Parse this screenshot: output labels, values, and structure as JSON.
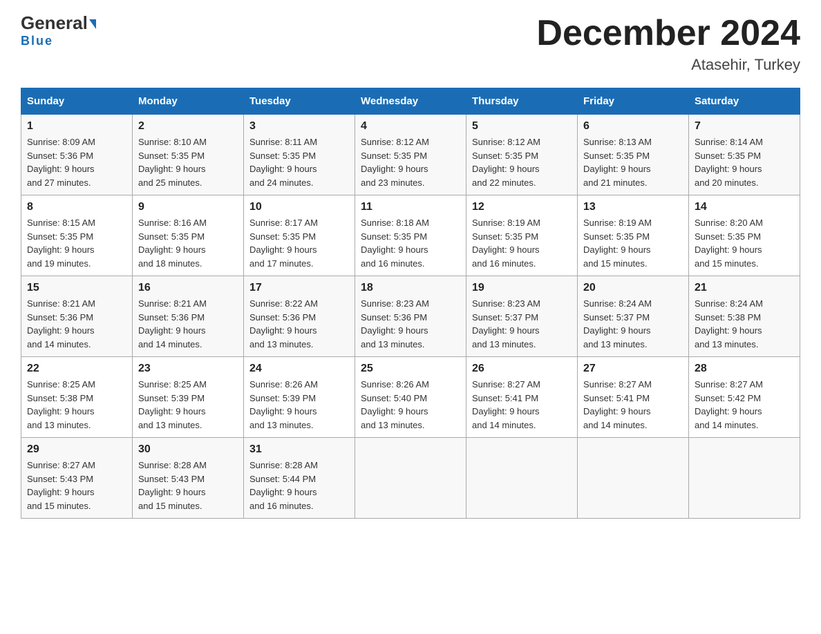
{
  "header": {
    "logo_general": "General",
    "logo_blue": "Blue",
    "title": "December 2024",
    "location": "Atasehir, Turkey"
  },
  "days_of_week": [
    "Sunday",
    "Monday",
    "Tuesday",
    "Wednesday",
    "Thursday",
    "Friday",
    "Saturday"
  ],
  "weeks": [
    [
      {
        "day": "1",
        "sunrise": "8:09 AM",
        "sunset": "5:36 PM",
        "daylight": "9 hours and 27 minutes."
      },
      {
        "day": "2",
        "sunrise": "8:10 AM",
        "sunset": "5:35 PM",
        "daylight": "9 hours and 25 minutes."
      },
      {
        "day": "3",
        "sunrise": "8:11 AM",
        "sunset": "5:35 PM",
        "daylight": "9 hours and 24 minutes."
      },
      {
        "day": "4",
        "sunrise": "8:12 AM",
        "sunset": "5:35 PM",
        "daylight": "9 hours and 23 minutes."
      },
      {
        "day": "5",
        "sunrise": "8:12 AM",
        "sunset": "5:35 PM",
        "daylight": "9 hours and 22 minutes."
      },
      {
        "day": "6",
        "sunrise": "8:13 AM",
        "sunset": "5:35 PM",
        "daylight": "9 hours and 21 minutes."
      },
      {
        "day": "7",
        "sunrise": "8:14 AM",
        "sunset": "5:35 PM",
        "daylight": "9 hours and 20 minutes."
      }
    ],
    [
      {
        "day": "8",
        "sunrise": "8:15 AM",
        "sunset": "5:35 PM",
        "daylight": "9 hours and 19 minutes."
      },
      {
        "day": "9",
        "sunrise": "8:16 AM",
        "sunset": "5:35 PM",
        "daylight": "9 hours and 18 minutes."
      },
      {
        "day": "10",
        "sunrise": "8:17 AM",
        "sunset": "5:35 PM",
        "daylight": "9 hours and 17 minutes."
      },
      {
        "day": "11",
        "sunrise": "8:18 AM",
        "sunset": "5:35 PM",
        "daylight": "9 hours and 16 minutes."
      },
      {
        "day": "12",
        "sunrise": "8:19 AM",
        "sunset": "5:35 PM",
        "daylight": "9 hours and 16 minutes."
      },
      {
        "day": "13",
        "sunrise": "8:19 AM",
        "sunset": "5:35 PM",
        "daylight": "9 hours and 15 minutes."
      },
      {
        "day": "14",
        "sunrise": "8:20 AM",
        "sunset": "5:35 PM",
        "daylight": "9 hours and 15 minutes."
      }
    ],
    [
      {
        "day": "15",
        "sunrise": "8:21 AM",
        "sunset": "5:36 PM",
        "daylight": "9 hours and 14 minutes."
      },
      {
        "day": "16",
        "sunrise": "8:21 AM",
        "sunset": "5:36 PM",
        "daylight": "9 hours and 14 minutes."
      },
      {
        "day": "17",
        "sunrise": "8:22 AM",
        "sunset": "5:36 PM",
        "daylight": "9 hours and 13 minutes."
      },
      {
        "day": "18",
        "sunrise": "8:23 AM",
        "sunset": "5:36 PM",
        "daylight": "9 hours and 13 minutes."
      },
      {
        "day": "19",
        "sunrise": "8:23 AM",
        "sunset": "5:37 PM",
        "daylight": "9 hours and 13 minutes."
      },
      {
        "day": "20",
        "sunrise": "8:24 AM",
        "sunset": "5:37 PM",
        "daylight": "9 hours and 13 minutes."
      },
      {
        "day": "21",
        "sunrise": "8:24 AM",
        "sunset": "5:38 PM",
        "daylight": "9 hours and 13 minutes."
      }
    ],
    [
      {
        "day": "22",
        "sunrise": "8:25 AM",
        "sunset": "5:38 PM",
        "daylight": "9 hours and 13 minutes."
      },
      {
        "day": "23",
        "sunrise": "8:25 AM",
        "sunset": "5:39 PM",
        "daylight": "9 hours and 13 minutes."
      },
      {
        "day": "24",
        "sunrise": "8:26 AM",
        "sunset": "5:39 PM",
        "daylight": "9 hours and 13 minutes."
      },
      {
        "day": "25",
        "sunrise": "8:26 AM",
        "sunset": "5:40 PM",
        "daylight": "9 hours and 13 minutes."
      },
      {
        "day": "26",
        "sunrise": "8:27 AM",
        "sunset": "5:41 PM",
        "daylight": "9 hours and 14 minutes."
      },
      {
        "day": "27",
        "sunrise": "8:27 AM",
        "sunset": "5:41 PM",
        "daylight": "9 hours and 14 minutes."
      },
      {
        "day": "28",
        "sunrise": "8:27 AM",
        "sunset": "5:42 PM",
        "daylight": "9 hours and 14 minutes."
      }
    ],
    [
      {
        "day": "29",
        "sunrise": "8:27 AM",
        "sunset": "5:43 PM",
        "daylight": "9 hours and 15 minutes."
      },
      {
        "day": "30",
        "sunrise": "8:28 AM",
        "sunset": "5:43 PM",
        "daylight": "9 hours and 15 minutes."
      },
      {
        "day": "31",
        "sunrise": "8:28 AM",
        "sunset": "5:44 PM",
        "daylight": "9 hours and 16 minutes."
      },
      null,
      null,
      null,
      null
    ]
  ],
  "labels": {
    "sunrise": "Sunrise:",
    "sunset": "Sunset:",
    "daylight": "Daylight:"
  }
}
